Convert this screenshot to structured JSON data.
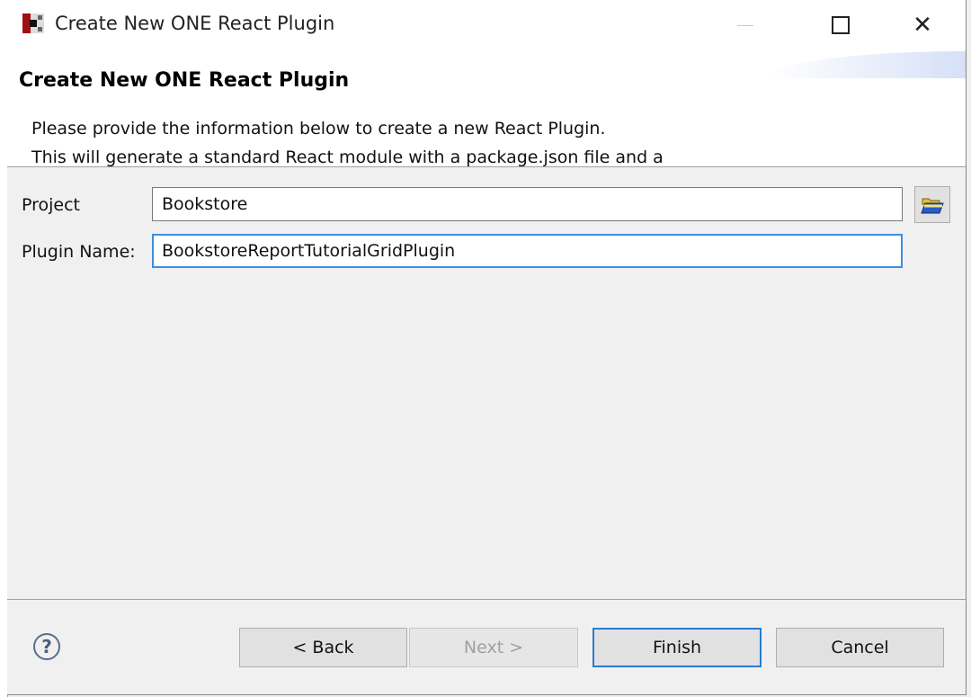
{
  "window": {
    "title": "Create New ONE React Plugin",
    "minimize_icon": "minimize-icon",
    "maximize_icon": "maximize-icon",
    "close_icon": "close-icon"
  },
  "header": {
    "title": "Create New ONE React Plugin",
    "description_line1": "Please provide the information below to create a new React Plugin.",
    "description_line2": "This will generate a standard React module with a package.json file and a"
  },
  "form": {
    "project_label": "Project",
    "project_value": "Bookstore",
    "plugin_label": "Plugin Name:",
    "plugin_value": "BookstoreReportTutorialGridPlugin",
    "browse_icon": "folder-open-icon"
  },
  "buttons": {
    "back": "< Back",
    "next": "Next >",
    "finish": "Finish",
    "cancel": "Cancel"
  },
  "colors": {
    "focus_border": "#3d8ee0",
    "default_button_border": "#2a7bd4"
  }
}
